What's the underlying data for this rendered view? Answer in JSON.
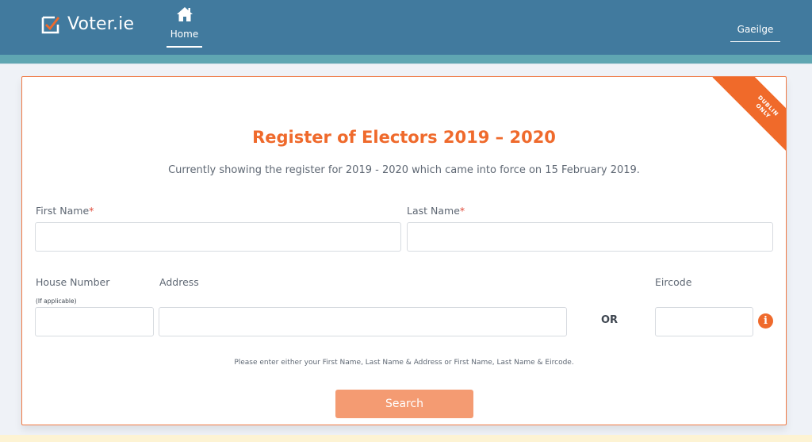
{
  "header": {
    "brand": "Voter.ie",
    "nav": [
      {
        "label": "Home",
        "icon": "home-icon",
        "active": true
      }
    ],
    "language_link": "Gaeilge"
  },
  "colors": {
    "header_bg": "#417a9e",
    "subbar": "#5fa6b2",
    "accent": "#ef6a2c",
    "button": "#f49b72"
  },
  "card": {
    "ribbon": [
      "DUBLIN",
      "ONLY"
    ],
    "title": "Register of Electors 2019 – 2020",
    "subtitle": "Currently showing the register for 2019 - 2020 which came into force on 15 February 2019.",
    "fields": {
      "first_name": {
        "label": "First Name",
        "required_mark": "*",
        "value": "",
        "placeholder": ""
      },
      "last_name": {
        "label": "Last Name",
        "required_mark": "*",
        "value": "",
        "placeholder": ""
      },
      "house_number": {
        "label": "House Number",
        "note": "(If applicable)",
        "value": "",
        "placeholder": ""
      },
      "address": {
        "label": "Address",
        "value": "",
        "placeholder": ""
      },
      "eircode": {
        "label": "Eircode",
        "value": "",
        "placeholder": ""
      }
    },
    "or_text": "OR",
    "info_icon": "info-icon",
    "hint": "Please enter either your First Name, Last Name & Address or First Name, Last Name & Eircode.",
    "search_label": "Search"
  }
}
